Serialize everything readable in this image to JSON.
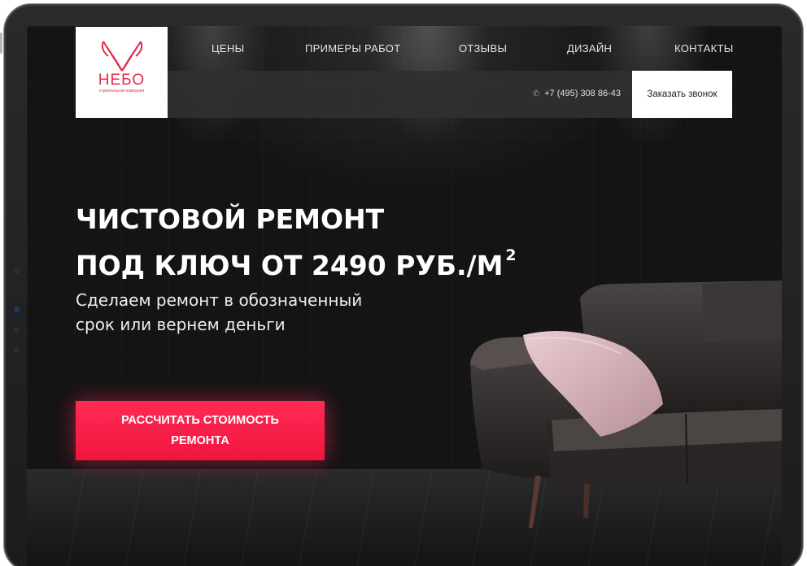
{
  "nav": {
    "items": [
      {
        "label": "ЦЕНЫ"
      },
      {
        "label": "ПРИМЕРЫ РАБОТ"
      },
      {
        "label": "ОТЗЫВЫ"
      },
      {
        "label": "ДИЗАЙН"
      },
      {
        "label": "КОНТАКТЫ"
      }
    ]
  },
  "logo": {
    "name": "НЕБО",
    "tagline": "строительная компания"
  },
  "header": {
    "phone": "+7 (495) 308 86-43",
    "phone_icon": "phone-icon",
    "call_button": "Заказать звонок"
  },
  "hero": {
    "title_line1": "ЧИСТОВОЙ РЕМОНТ",
    "title_line2": "ПОД КЛЮЧ ОТ 2490 РУБ./М",
    "title_sup": "2",
    "subtitle_line1": "Сделаем ремонт в обозначенный",
    "subtitle_line2": "срок или вернем деньги",
    "cta_label": "РАССЧИТАТЬ СТОИМОСТЬ РЕМОНТА"
  },
  "colors": {
    "accent": "#f0153f",
    "logo": "#e32a4b",
    "background": "#141415"
  }
}
